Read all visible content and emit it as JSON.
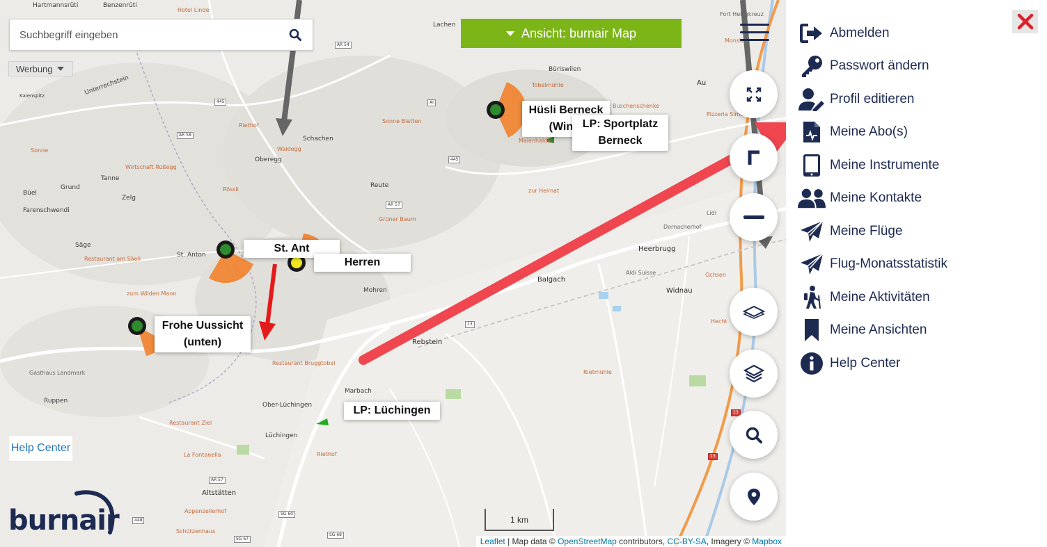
{
  "search": {
    "placeholder": "Suchbegriff eingeben"
  },
  "ads": {
    "label": "Werbung"
  },
  "view_selector": {
    "label": "Ansicht: burnair Map"
  },
  "map": {
    "places": [
      {
        "name": "Hartmannsrüti"
      },
      {
        "name": "Benzenrüti"
      },
      {
        "name": "Lachen"
      },
      {
        "name": "Büriswilen"
      },
      {
        "name": "Schachen"
      },
      {
        "name": "Oberegg"
      },
      {
        "name": "Tanne"
      },
      {
        "name": "Grund"
      },
      {
        "name": "Büel"
      },
      {
        "name": "Zelg"
      },
      {
        "name": "Farenschwendi"
      },
      {
        "name": "Reute"
      },
      {
        "name": "Säge"
      },
      {
        "name": "St. Anton"
      },
      {
        "name": "Mohren"
      },
      {
        "name": "Balgach"
      },
      {
        "name": "Heerbrugg"
      },
      {
        "name": "Widnau"
      },
      {
        "name": "Rebstein"
      },
      {
        "name": "Marbach"
      },
      {
        "name": "Ober-Lüchingen"
      },
      {
        "name": "Ruppen"
      },
      {
        "name": "Lüchingen"
      },
      {
        "name": "Altstätten"
      },
      {
        "name": "Au"
      },
      {
        "name": "Unterrechstein"
      },
      {
        "name": "Kaienspitz"
      }
    ],
    "pois": [
      {
        "name": "Hotel Linde"
      },
      {
        "name": "Restaurant Rebstock"
      },
      {
        "name": "Riethof"
      },
      {
        "name": "Waldegg"
      },
      {
        "name": "Sonne"
      },
      {
        "name": "Wirtschaft Rüßegg"
      },
      {
        "name": "Rössli"
      },
      {
        "name": "Sonne Blatten"
      },
      {
        "name": "Tobelmühle"
      },
      {
        "name": "Buschenschenke"
      },
      {
        "name": "Maienhalde"
      },
      {
        "name": "zur Heimat"
      },
      {
        "name": "Grüner Baum"
      },
      {
        "name": "Restaurant am Säeli"
      },
      {
        "name": "zum Wilden Mann"
      },
      {
        "name": "Gasthaus Landmark"
      },
      {
        "name": "Restaurant Bruggtobel"
      },
      {
        "name": "Restaurant Ziel"
      },
      {
        "name": "La Fontanella"
      },
      {
        "name": "Riethof"
      },
      {
        "name": "Appenzellerhof"
      },
      {
        "name": "Schützenhaus"
      },
      {
        "name": "Rietmühle"
      },
      {
        "name": "Hecht"
      },
      {
        "name": "Ochsen"
      },
      {
        "name": "Aldi Suisse"
      },
      {
        "name": "Lidl"
      },
      {
        "name": "Dornacherhof"
      },
      {
        "name": "Pizzeria Simone"
      },
      {
        "name": "Fort Heiligkreuz"
      },
      {
        "name": "Monstein"
      }
    ],
    "road_shields": [
      "AR 54",
      "445",
      "AI",
      "AR 58",
      "445",
      "AR 57",
      "13",
      "AR 57",
      "448",
      "SG 67",
      "SG 60",
      "SG 68",
      "13",
      "13"
    ]
  },
  "labels": {
    "husli": {
      "line1": "Hüsli Berneck",
      "line2": "(Winte"
    },
    "sportplatz": {
      "line1": "LP: Sportplatz",
      "line2": "Berneck"
    },
    "st_anton": "St. Ant",
    "herren": "Herren",
    "frohe": {
      "line1": "Frohe Uussicht",
      "line2": "(unten)"
    },
    "luchingen": "LP: Lüchingen"
  },
  "help_link": "Help Center",
  "logo": "burnair",
  "scale": "1 km",
  "attribution": {
    "leaflet": "Leaflet",
    "sep1": " | Map data © ",
    "osm": "OpenStreetMap",
    "mid": " contributors, ",
    "license": "CC-BY-SA",
    "imagery": ", Imagery © ",
    "mapbox": "Mapbox"
  },
  "map_controls": [
    "expand-icon",
    "locate-north-icon",
    "zoom-out-icon",
    "layer-icon",
    "layers-icon",
    "search-icon",
    "location-pin-icon"
  ],
  "sidebar": {
    "items": [
      {
        "label": "Abmelden",
        "icon": "sign-out-icon"
      },
      {
        "label": "Passwort ändern",
        "icon": "key-icon"
      },
      {
        "label": "Profil editieren",
        "icon": "user-edit-icon"
      },
      {
        "label": "Meine Abo(s)",
        "icon": "file-document-icon"
      },
      {
        "label": "Meine Instrumente",
        "icon": "tablet-icon"
      },
      {
        "label": "Meine Kontakte",
        "icon": "users-icon"
      },
      {
        "label": "Meine Flüge",
        "icon": "paper-plane-icon"
      },
      {
        "label": "Flug-Monatsstatistik",
        "icon": "paper-plane-icon"
      },
      {
        "label": "Meine Aktivitäten",
        "icon": "hiker-icon"
      },
      {
        "label": "Meine Ansichten",
        "icon": "bookmark-icon"
      },
      {
        "label": "Help Center",
        "icon": "info-icon"
      }
    ]
  },
  "colors": {
    "navy": "#1d2a52",
    "green": "#7cb518",
    "orange": "#f08a3c",
    "red_arrow": "#f0464f",
    "close_red": "#d9232a"
  }
}
